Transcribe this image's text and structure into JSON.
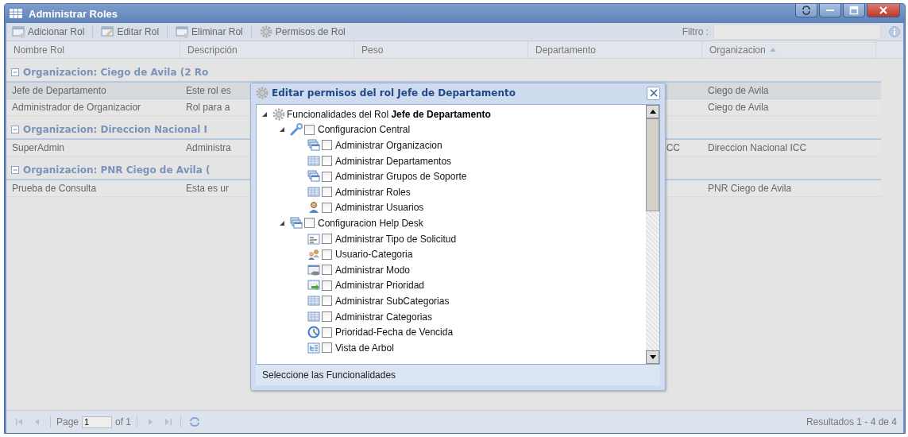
{
  "window": {
    "title": "Administrar Roles"
  },
  "toolbar": {
    "buttons": [
      {
        "label": "Adicionar Rol",
        "kind": "add"
      },
      {
        "label": "Editar Rol",
        "kind": "edit"
      },
      {
        "label": "Eliminar Rol",
        "kind": "delete"
      },
      {
        "label": "Permisos de Rol",
        "kind": "gear"
      }
    ],
    "filter": {
      "label": "Filtro :"
    }
  },
  "table": {
    "columns": [
      {
        "label": "Nombre Rol",
        "sorted": false
      },
      {
        "label": "Descripción",
        "sorted": false
      },
      {
        "label": "Peso",
        "sorted": false
      },
      {
        "label": "Departamento",
        "sorted": false
      },
      {
        "label": "Organizacion",
        "sorted": true
      }
    ],
    "groups": [
      {
        "label": "Organizacion: Ciego de Avila (2 Ro",
        "expanded": true,
        "rows": [
          {
            "cells": [
              "Jefe de Departamento",
              "Este rol es",
              "",
              "",
              "Ciego de Avila"
            ],
            "selected": true
          },
          {
            "cells": [
              "Administrador de Organizacior",
              "Rol para a",
              "",
              "",
              "Ciego de Avila"
            ],
            "selected": false
          }
        ]
      },
      {
        "label": "Organizacion: Direccion Nacional I",
        "expanded": true,
        "rows": [
          {
            "cells": [
              "SuperAdmin",
              "Administra",
              "",
              "CC",
              "Direccion Nacional ICC"
            ],
            "selected": false
          }
        ]
      },
      {
        "label": "Organizacion: PNR Ciego de Avila (",
        "expanded": true,
        "rows": [
          {
            "cells": [
              "Prueba de Consulta",
              "Esta es ur",
              "",
              "",
              "PNR Ciego de Avila"
            ],
            "selected": false
          }
        ]
      }
    ]
  },
  "pager": {
    "page_label": "Page",
    "page": "1",
    "of": "of 1",
    "summary": "Resultados 1 - 4 de 4"
  },
  "dialog": {
    "title": "Editar permisos del rol Jefe de Departamento",
    "tree": [
      {
        "label": "Funcionalidades del Rol **Jefe de Departamento**",
        "kind": "gear",
        "expanded": true,
        "children": [
          {
            "label": "Configuracion Central",
            "kind": "wrench",
            "checked": false,
            "expanded": true,
            "children": [
              {
                "label": "Administrar Organizacion",
                "kind": "windows",
                "checked": false
              },
              {
                "label": "Administrar Departamentos",
                "kind": "grid",
                "checked": false
              },
              {
                "label": "Administrar Grupos de Soporte",
                "kind": "windows",
                "checked": false
              },
              {
                "label": "Administrar Roles",
                "kind": "grid",
                "checked": false
              },
              {
                "label": "Administrar Usuarios",
                "kind": "user",
                "checked": false
              }
            ]
          },
          {
            "label": "Configuracion Help Desk",
            "kind": "windows",
            "checked": false,
            "expanded": true,
            "children": [
              {
                "label": "Administrar Tipo de Solicitud",
                "kind": "form",
                "checked": false
              },
              {
                "label": "Usuario-Categoria",
                "kind": "users",
                "checked": false
              },
              {
                "label": "Administrar Modo",
                "kind": "mode",
                "checked": false
              },
              {
                "label": "Administrar Prioridad",
                "kind": "arrow",
                "checked": false
              },
              {
                "label": "Administrar SubCategorias",
                "kind": "grid",
                "checked": false
              },
              {
                "label": "Administrar Categorias",
                "kind": "grid",
                "checked": false
              },
              {
                "label": "Prioridad-Fecha de Vencida",
                "kind": "clock",
                "checked": false
              },
              {
                "label": "Vista de Arbol",
                "kind": "tree",
                "checked": false
              }
            ]
          }
        ]
      }
    ],
    "footer": "Seleccione las Funcionalidades"
  }
}
